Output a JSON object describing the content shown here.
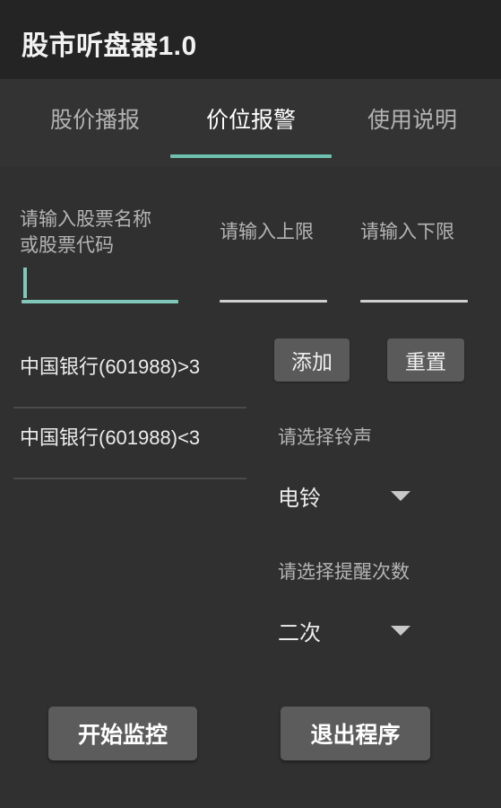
{
  "app": {
    "title": "股市听盘器1.0",
    "accent_color": "#6fc0b0",
    "background_color": "#303030",
    "titlebar_color": "#242424",
    "button_color": "#5a5a5a"
  },
  "tabs": [
    {
      "label": "股价播报",
      "active": false
    },
    {
      "label": "价位报警",
      "active": true
    },
    {
      "label": "使用说明",
      "active": false
    }
  ],
  "form": {
    "stock": {
      "label": "请输入股票名称\n或股票代码",
      "value": "",
      "placeholder": "",
      "focused": true
    },
    "upper": {
      "label": "请输入上限",
      "value": "",
      "placeholder": "",
      "focused": false
    },
    "lower": {
      "label": "请输入下限",
      "value": "",
      "placeholder": "",
      "focused": false
    },
    "add_label": "添加",
    "reset_label": "重置"
  },
  "alerts": [
    {
      "label": "中国银行(601988)>3"
    },
    {
      "label": "中国银行(601988)<3"
    }
  ],
  "selects": {
    "ringtone": {
      "label": "请选择铃声",
      "value": "电铃",
      "arrow_icon": "chevron-down-icon"
    },
    "repeat": {
      "label": "请选择提醒次数",
      "value": "二次",
      "arrow_icon": "chevron-down-icon"
    }
  },
  "actions": {
    "start_label": "开始监控",
    "exit_label": "退出程序"
  }
}
